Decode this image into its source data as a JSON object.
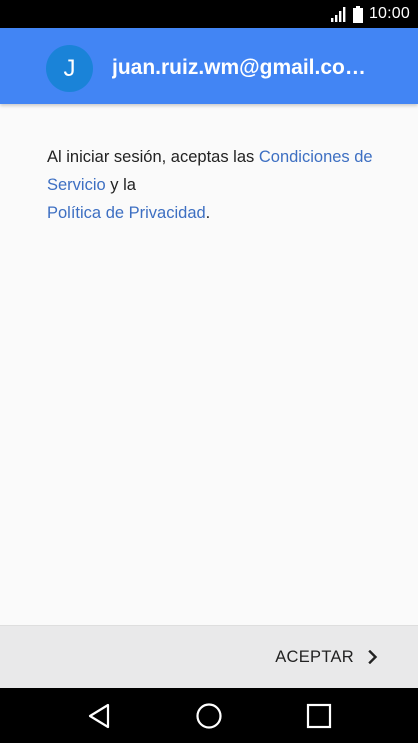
{
  "status_bar": {
    "time": "10:00",
    "icons": [
      "signal-icon",
      "battery-icon"
    ]
  },
  "header": {
    "avatar_letter": "J",
    "email": "juan.ruiz.wm@gmail.co…"
  },
  "terms": {
    "text_before": "Al iniciar sesión, aceptas las ",
    "tos_link": "Condiciones de Servicio",
    "text_middle": " y la ",
    "privacy_link": "Política de Privacidad",
    "text_after": "."
  },
  "footer": {
    "accept_label": "ACEPTAR",
    "accept_icon": "chevron-right-icon"
  },
  "nav_bar": {
    "icons": [
      "back-icon",
      "home-icon",
      "recents-icon"
    ]
  },
  "colors": {
    "header_bg": "#4285f4",
    "avatar_bg": "#1a83d8",
    "link": "#3d6fc2",
    "content_bg": "#fafafa",
    "footer_bg": "#e9e9ea"
  }
}
